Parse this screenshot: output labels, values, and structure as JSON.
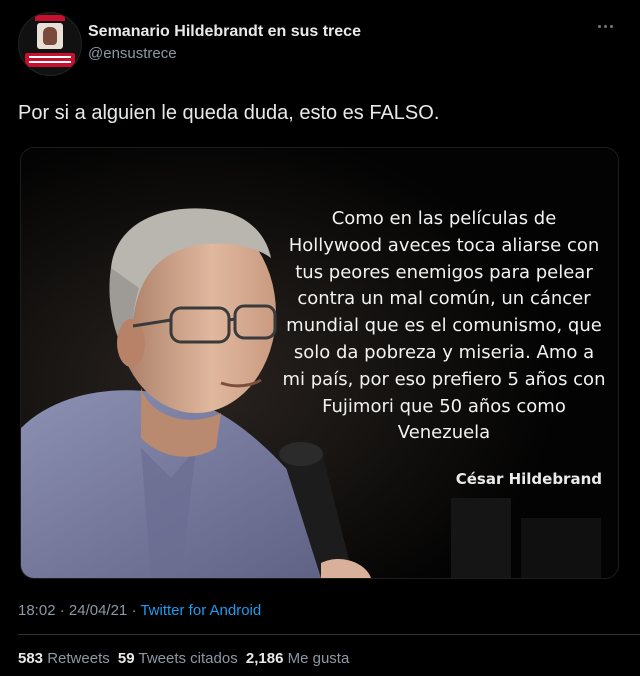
{
  "author": {
    "display_name": "Semanario Hildebrandt en sus trece",
    "handle": "@ensustrece",
    "avatar_icon": "magazine-cover-avatar"
  },
  "tweet": {
    "text": "Por si a alguien le queda duda, esto es FALSO."
  },
  "media": {
    "quote_lines": [
      "Como en las películas de",
      "Hollywood aveces toca aliarse con",
      "tus peores enemigos para pelear",
      "contra un mal común, un cáncer",
      "mundial que es el comunismo, que",
      "solo da pobreza y miseria. Amo a",
      "mi país, por eso prefiero 5 años con",
      "Fujimori que 50 años como",
      "Venezuela"
    ],
    "attribution": "César Hildebrand"
  },
  "meta": {
    "time": "18:02",
    "separator1": " · ",
    "date": "24/04/21",
    "separator2": " · ",
    "source": "Twitter for Android"
  },
  "stats": {
    "retweets_count": "583",
    "retweets_label": "Retweets",
    "quotes_count": "59",
    "quotes_label": "Tweets citados",
    "likes_count": "2,186",
    "likes_label": "Me gusta"
  },
  "colors": {
    "background": "#000000",
    "link": "#1d9bf0",
    "secondary_text": "#8b98a5",
    "primary_text": "#e7e9ea"
  }
}
